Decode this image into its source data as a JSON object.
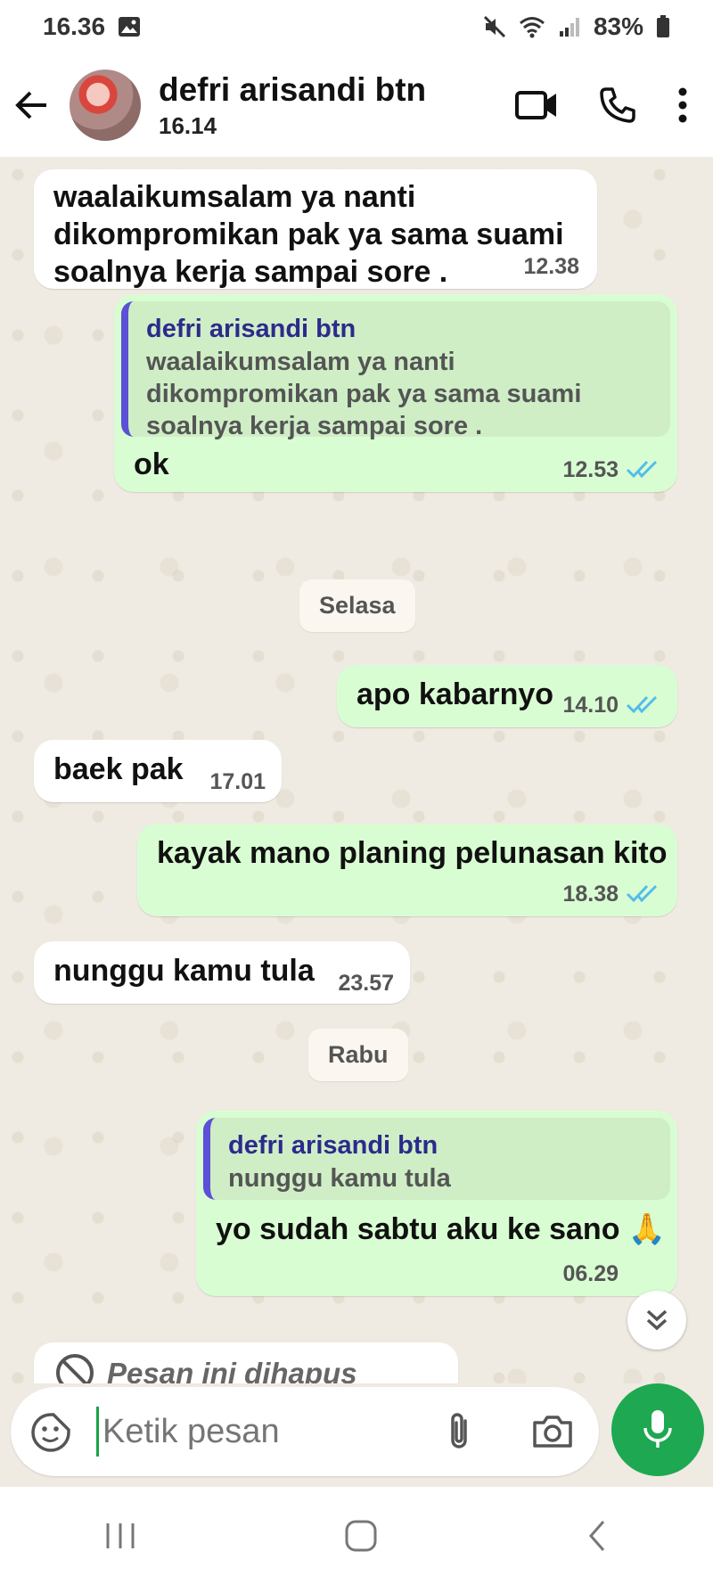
{
  "status_bar": {
    "time": "16.36",
    "battery": "83%"
  },
  "header": {
    "contact_name": "defri arisandi btn",
    "contact_status": "16.14"
  },
  "messages": [
    {
      "line1": "waalaikumsalam ya nanti",
      "line2": "dikompromikan pak ya sama suami",
      "line3": "soalnya kerja sampai sore .",
      "time": "12.38"
    },
    {
      "quote_name": "defri arisandi btn",
      "quote_line1": "waalaikumsalam ya nanti",
      "quote_line2": "dikompromikan pak ya sama suami",
      "quote_line3": "soalnya kerja sampai sore .",
      "text": "ok",
      "time": "12.53"
    },
    {
      "text": "apo kabarnyo",
      "time": "14.10"
    },
    {
      "text": "baek pak",
      "time": "17.01"
    },
    {
      "text": "kayak mano planing pelunasan kito",
      "time": "18.38"
    },
    {
      "text": "nunggu kamu tula",
      "time": "23.57"
    },
    {
      "quote_name": "defri arisandi btn",
      "quote_text": "nunggu kamu tula",
      "text": "yo sudah sabtu aku ke sano 🙏",
      "time": "06.29"
    },
    {
      "text": "Pesan ini dihapus"
    }
  ],
  "day_labels": {
    "selasa": "Selasa",
    "rabu": "Rabu"
  },
  "input": {
    "placeholder": "Ketik pesan"
  },
  "colors": {
    "accent": "#1da851",
    "outgoing": "#d9fdd3",
    "incoming": "#ffffff",
    "tick": "#53bdeb",
    "quote_bar": "#5b50d6"
  }
}
